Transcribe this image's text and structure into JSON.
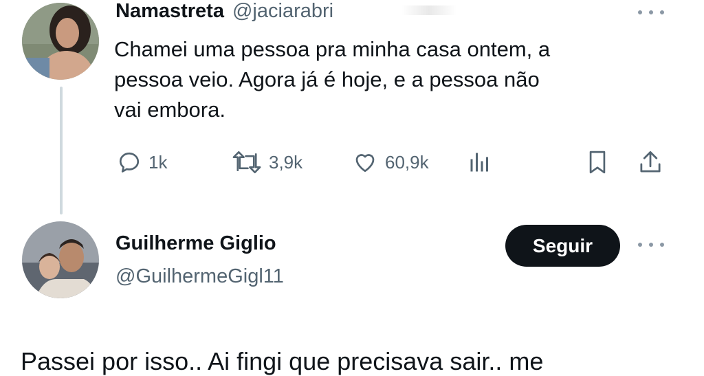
{
  "tweet": {
    "author_name": "Namastreta",
    "author_handle": "@jaciarabri",
    "text_lines": [
      "Chamei uma pessoa pra minha casa ontem, a",
      "pessoa veio. Agora já é hoje, e a pessoa não",
      "vai embora."
    ],
    "actions": {
      "replies": "1k",
      "retweets": "3,9k",
      "likes": "60,9k"
    },
    "icons": [
      "reply-icon",
      "retweet-icon",
      "like-icon",
      "views-icon",
      "bookmark-icon",
      "share-icon",
      "more-icon"
    ]
  },
  "reply": {
    "author_name": "Guilherme Giglio",
    "author_handle": "@GuilhermeGigl11",
    "follow_label": "Seguir",
    "text_partial": "Passei por isso.. Ai fingi que precisava sair.. me"
  },
  "colors": {
    "text": "#0f1419",
    "secondary": "#536471",
    "button_bg": "#0f1419",
    "button_text": "#ffffff",
    "thread_line": "#cfd9de"
  }
}
